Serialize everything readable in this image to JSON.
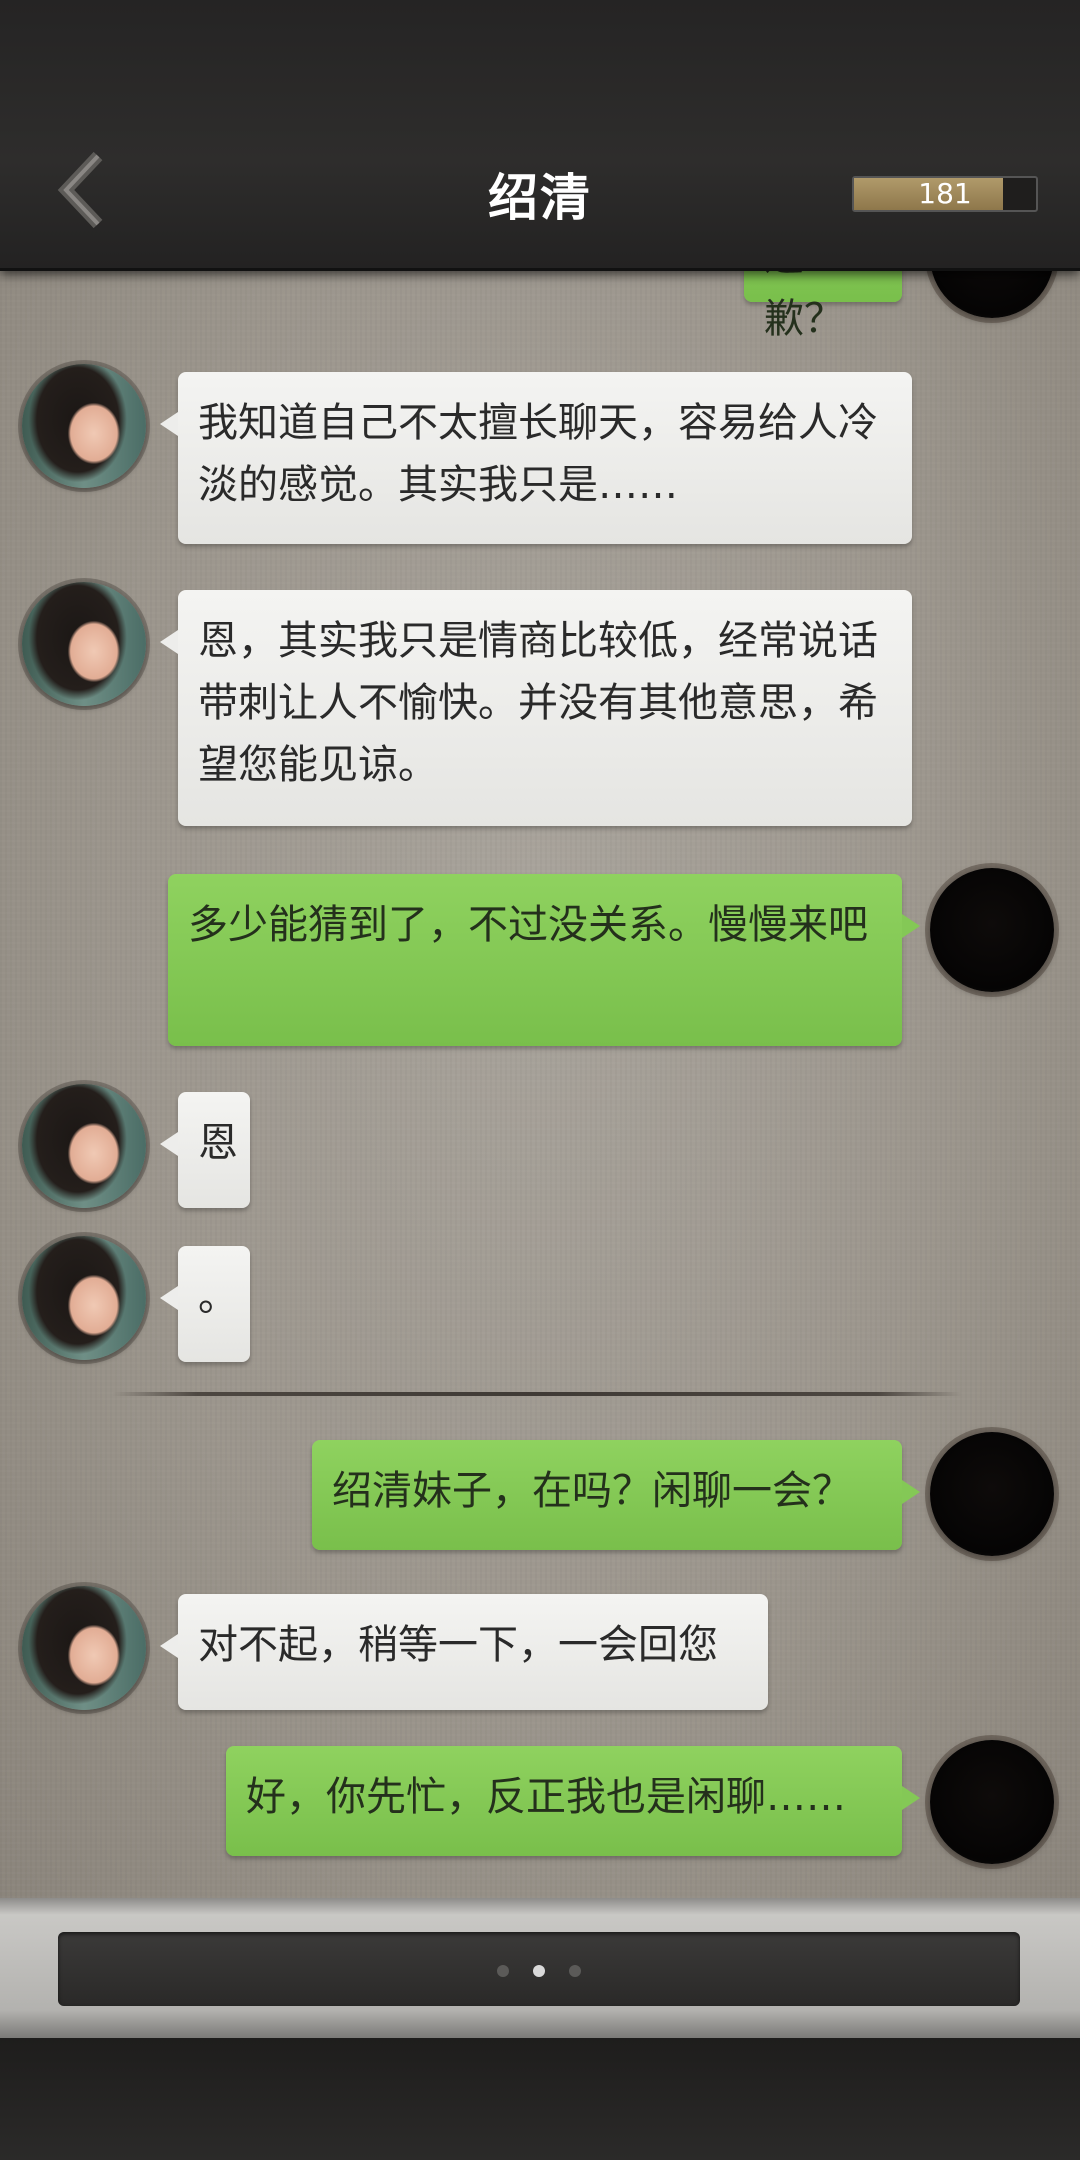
{
  "header": {
    "title": "绍清",
    "score": "181",
    "score_progress": 0.82
  },
  "messages": [
    {
      "side": "right",
      "text": "道歉？"
    },
    {
      "side": "left",
      "text": "我知道自己不太擅长聊天，容易给人冷淡的感觉。其实我只是……"
    },
    {
      "side": "left",
      "text": "恩，其实我只是情商比较低，经常说话带刺让人不愉快。并没有其他意思，希望您能见谅。"
    },
    {
      "side": "right",
      "text": "多少能猜到了，不过没关系。慢慢来吧"
    },
    {
      "side": "left",
      "text": "恩"
    },
    {
      "side": "left",
      "text": "。"
    },
    {
      "side": "right",
      "text": "绍清妹子，在吗？闲聊一会？"
    },
    {
      "side": "left",
      "text": "对不起，稍等一下，一会回您"
    },
    {
      "side": "right",
      "text": "好，你先忙，反正我也是闲聊……"
    }
  ],
  "input": {
    "page_count": 3,
    "active_page": 2
  },
  "icons": {
    "back": "chevron-left-icon"
  },
  "colors": {
    "bubble_left": "#f0f0ee",
    "bubble_right": "#84c856",
    "header_bg": "#2a2928"
  }
}
